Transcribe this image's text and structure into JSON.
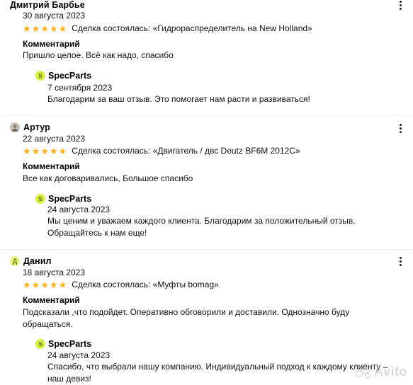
{
  "reviews": [
    {
      "author": "Дмитрий Барбье",
      "avatar_letter": "",
      "avatar_color": "#f0f0f0",
      "date": "30 августа 2023",
      "rating": 5,
      "deal": "Сделка состоялась: «Гидрораспределитель на New Holland»",
      "comment_label": "Комментарий",
      "comment": "Пришло целое. Всё как надо, спасибо",
      "reply": {
        "name": "SpecParts",
        "logo_letter": "S",
        "date": "7 сентября 2023",
        "text": "Благодарим за ваш отзыв. Это помогает нам расти и развиваться!"
      }
    },
    {
      "author": "Артур",
      "avatar_letter": "",
      "avatar_color": "#b9b0a6",
      "date": "22 августа 2023",
      "rating": 5,
      "deal": "Сделка состоялась: «Двигатель / двс Deutz BF6M 2012C»",
      "comment_label": "Комментарий",
      "comment": "Все как договаривались, Большое спасибо",
      "reply": {
        "name": "SpecParts",
        "logo_letter": "S",
        "date": "24 августа 2023",
        "text": "Мы ценим и уважаем каждого клиента. Благодарим за положительный отзыв. Обращайтесь к нам еще!"
      }
    },
    {
      "author": "Данил",
      "avatar_letter": "Д",
      "avatar_color": "#e9f58a",
      "date": "18 августа 2023",
      "rating": 5,
      "deal": "Сделка состоялась: «Муфты bomag»",
      "comment_label": "Комментарий",
      "comment": "Подсказали ,что подойдет. Оперативно обговорили и доставили. Однозначно буду обращаться.",
      "reply": {
        "name": "SpecParts",
        "logo_letter": "S",
        "date": "24 августа 2023",
        "text": "Спасибо, что выбрали нашу компанию. Индивидуальный подход к каждому клиенту – наш девиз!"
      }
    }
  ],
  "colors": {
    "star": "#ffb021",
    "brand_logo": "#d7ec45",
    "divider": "#eceff3"
  },
  "watermark": {
    "text": "Avito",
    "icon": "avito-logo-icon"
  }
}
